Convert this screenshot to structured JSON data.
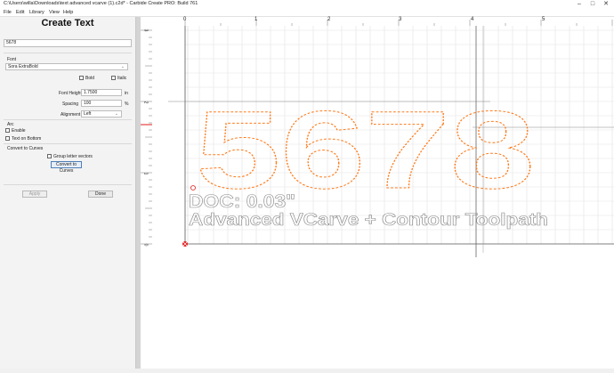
{
  "window": {
    "title": "C:\\Users\\willa\\Downloads\\text advanced vcarve (1).c2d* - Carbide Create PRO: Build 761",
    "min_glyph": "–",
    "max_glyph": "□",
    "close_glyph": "✕"
  },
  "menu": [
    "File",
    "Edit",
    "Library",
    "View",
    "Help"
  ],
  "panel": {
    "title": "Create Text",
    "text_value": "5678",
    "font_section": "Font",
    "font_value": "Sora ExtraBold",
    "bold_label": "Bold",
    "italic_label": "Italic",
    "font_height_label": "Font Height",
    "font_height_value": "1.7500",
    "font_height_unit": "in",
    "spacing_label": "Spacing",
    "spacing_value": "100",
    "spacing_unit": "%",
    "alignment_label": "Alignment",
    "alignment_value": "Left",
    "arc_section": "Arc",
    "enable_label": "Enable",
    "text_bottom_label": "Text on Bottom",
    "convert_section": "Convert to Curves",
    "group_label": "Group letter vectors",
    "convert_button": "Convert to Curves",
    "apply_button": "Apply",
    "done_button": "Done"
  },
  "ruler": {
    "top_labels": [
      "0",
      "1",
      "2",
      "3",
      "4",
      "5"
    ],
    "left_labels": [
      "3",
      "2",
      "1",
      "0"
    ]
  },
  "canvas": {
    "main_text": "5678",
    "line1": "DOC: 0.03\"",
    "line2": "Advanced VCarve + Contour Toolpath",
    "accent_color": "#ff7a1a",
    "grid_color": "#e3e3e3"
  }
}
